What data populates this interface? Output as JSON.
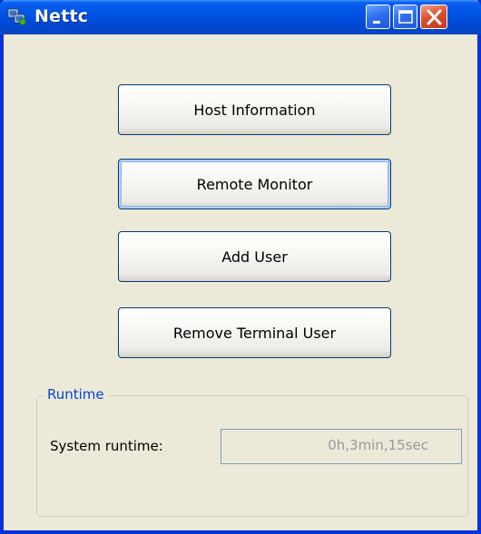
{
  "window": {
    "title": "Nettc",
    "icon": "network-monitor-icon",
    "accent_color": "#0055e5",
    "close_color": "#e0502e"
  },
  "buttons": {
    "host_information": "Host Information",
    "remote_monitor": "Remote Monitor",
    "add_user": "Add User",
    "remove_terminal_user": "Remove Terminal User"
  },
  "runtime_group": {
    "legend": "Runtime",
    "label": "System runtime:",
    "value": "0h,3min,15sec"
  }
}
